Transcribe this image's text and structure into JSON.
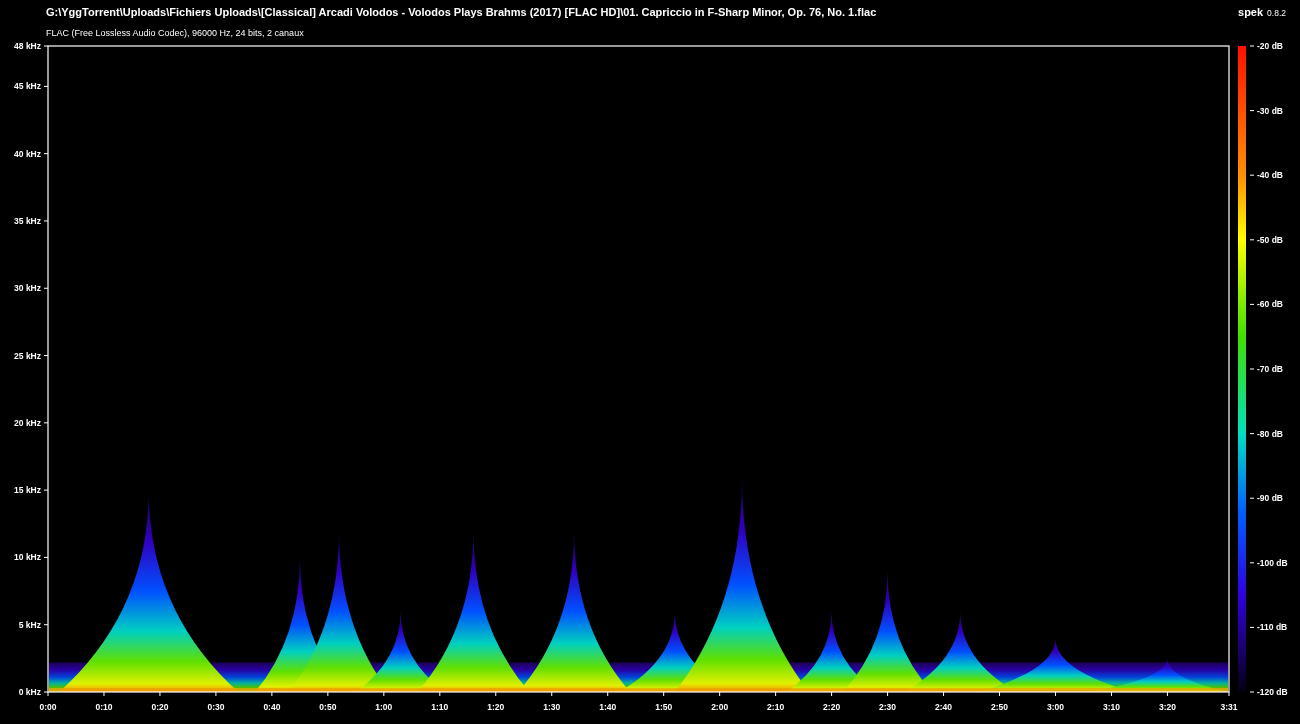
{
  "window": {
    "title": "G:\\YggTorrent\\Uploads\\Fichiers Uploads\\[Classical] Arcadi Volodos - Volodos Plays Brahms (2017) [FLAC HD]\\01. Capriccio in F-Sharp Minor, Op. 76, No. 1.flac"
  },
  "file_info": "FLAC (Free Lossless Audio Codec), 96000 Hz, 24 bits, 2 canaux",
  "app": {
    "name": "spek",
    "version": "0.8.2"
  },
  "frequency_axis": {
    "ticks": [
      "48 kHz",
      "45 kHz",
      "40 kHz",
      "35 kHz",
      "30 kHz",
      "25 kHz",
      "20 kHz",
      "15 kHz",
      "10 kHz",
      "5 kHz",
      "0 kHz"
    ]
  },
  "time_axis": {
    "ticks": [
      "0:00",
      "0:10",
      "0:20",
      "0:30",
      "0:40",
      "0:50",
      "1:00",
      "1:10",
      "1:20",
      "1:30",
      "1:40",
      "1:50",
      "2:00",
      "2:10",
      "2:20",
      "2:30",
      "2:40",
      "2:50",
      "3:00",
      "3:10",
      "3:20",
      "3:31"
    ]
  },
  "level_scale": {
    "ticks": [
      "-20 dB",
      "-30 dB",
      "-40 dB",
      "-50 dB",
      "-60 dB",
      "-70 dB",
      "-80 dB",
      "-90 dB",
      "-100 dB",
      "-110 dB",
      "-120 dB"
    ]
  }
}
